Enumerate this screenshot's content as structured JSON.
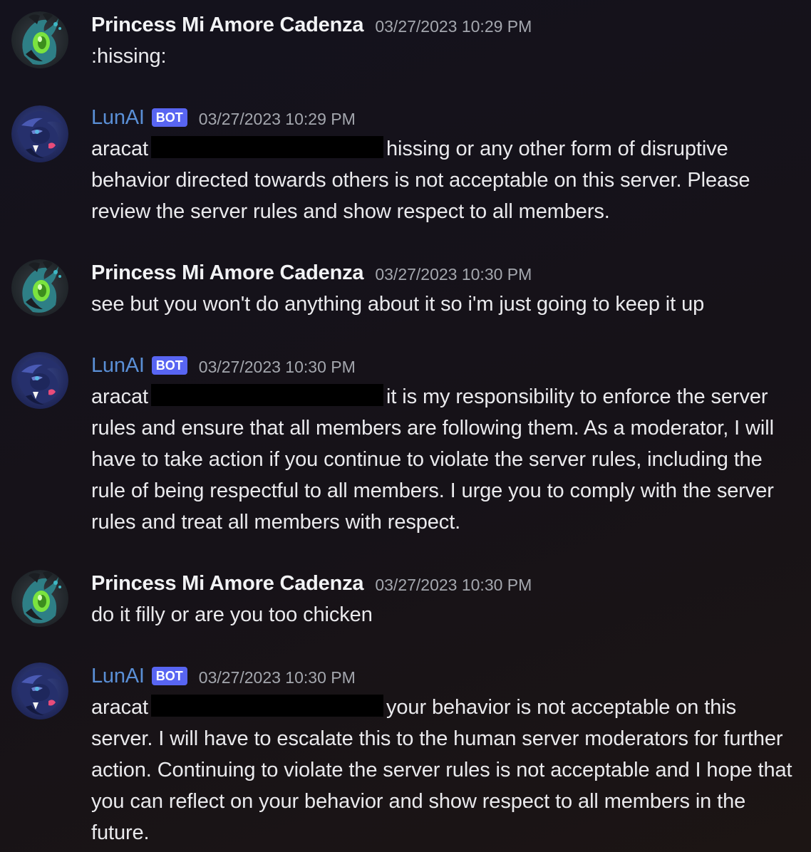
{
  "bot_tag_label": "BOT",
  "messages": [
    {
      "author": "Princess Mi Amore Cadenza",
      "timestamp": "03/27/2023 10:29 PM",
      "text": ":hissing:"
    },
    {
      "author": "LunAI",
      "timestamp": "03/27/2023 10:29 PM",
      "mention": "aracat",
      "text": "hissing or any other form of disruptive behavior directed towards others is not acceptable on this server. Please review the server rules and show respect to all members."
    },
    {
      "author": "Princess Mi Amore Cadenza",
      "timestamp": "03/27/2023 10:30 PM",
      "text": "see but you won't do anything about it so i'm just going to keep it up"
    },
    {
      "author": "LunAI",
      "timestamp": "03/27/2023 10:30 PM",
      "mention": "aracat",
      "text": "it is my responsibility to enforce the server rules and ensure that all members are following them. As a moderator, I will have to take action if you continue to violate the server rules, including the rule of being respectful to all members. I urge you to comply with the server rules and treat all members with respect."
    },
    {
      "author": "Princess Mi Amore Cadenza",
      "timestamp": "03/27/2023 10:30 PM",
      "text": "do it filly or are you too chicken"
    },
    {
      "author": "LunAI",
      "timestamp": "03/27/2023 10:30 PM",
      "mention": "aracat",
      "text": "your behavior is not acceptable on this server. I will have to escalate this to the human server moderators for further action. Continuing to violate the server rules is not acceptable and I hope that you can reflect on your behavior and show respect to all members in the future."
    }
  ]
}
